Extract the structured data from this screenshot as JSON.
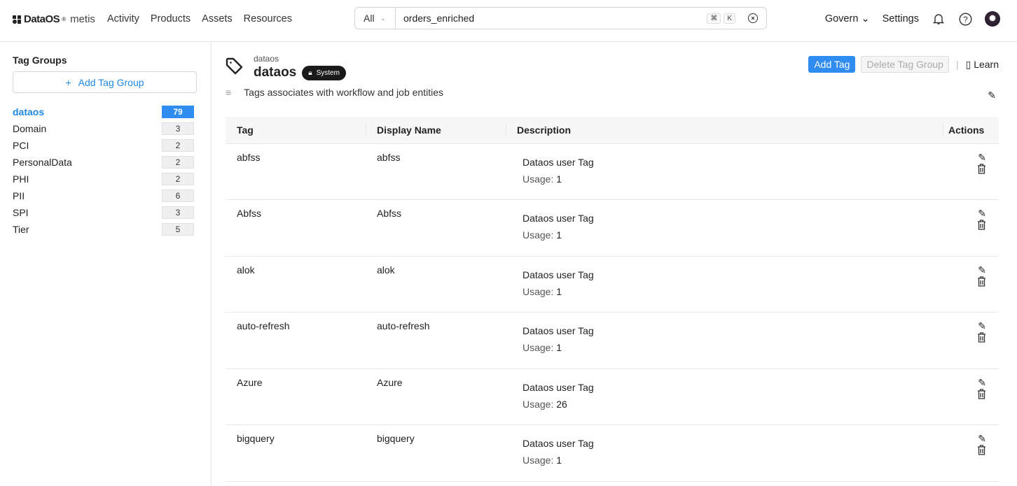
{
  "header": {
    "logo_brand": "DataOS",
    "logo_product": "metis",
    "nav": [
      "Activity",
      "Products",
      "Assets",
      "Resources"
    ],
    "search": {
      "scope": "All",
      "value": "orders_enriched",
      "kbd1": "⌘",
      "kbd2": "K"
    },
    "govern": "Govern",
    "settings": "Settings"
  },
  "sidebar": {
    "title": "Tag Groups",
    "add_label": "Add Tag Group",
    "groups": [
      {
        "name": "dataos",
        "count": "79",
        "active": true
      },
      {
        "name": "Domain",
        "count": "3"
      },
      {
        "name": "PCI",
        "count": "2"
      },
      {
        "name": "PersonalData",
        "count": "2"
      },
      {
        "name": "PHI",
        "count": "2"
      },
      {
        "name": "PII",
        "count": "6"
      },
      {
        "name": "SPI",
        "count": "3"
      },
      {
        "name": "Tier",
        "count": "5"
      }
    ]
  },
  "main": {
    "breadcrumb": "dataos",
    "title": "dataos",
    "badge": "System",
    "description": "Tags associates with workflow and job entities",
    "add_tag": "Add Tag",
    "delete_group": "Delete Tag Group",
    "learn": "Learn",
    "columns": [
      "Tag",
      "Display Name",
      "Description",
      "Actions"
    ],
    "usage_label": "Usage:",
    "rows": [
      {
        "tag": "abfss",
        "display": "abfss",
        "desc": "Dataos user Tag",
        "usage": "1"
      },
      {
        "tag": "Abfss",
        "display": "Abfss",
        "desc": "Dataos user Tag",
        "usage": "1"
      },
      {
        "tag": "alok",
        "display": "alok",
        "desc": "Dataos user Tag",
        "usage": "1"
      },
      {
        "tag": "auto-refresh",
        "display": "auto-refresh",
        "desc": "Dataos user Tag",
        "usage": "1"
      },
      {
        "tag": "Azure",
        "display": "Azure",
        "desc": "Dataos user Tag",
        "usage": "26"
      },
      {
        "tag": "bigquery",
        "display": "bigquery",
        "desc": "Dataos user Tag",
        "usage": "1"
      }
    ]
  },
  "colors": {
    "accent": "#2f8cf0"
  }
}
